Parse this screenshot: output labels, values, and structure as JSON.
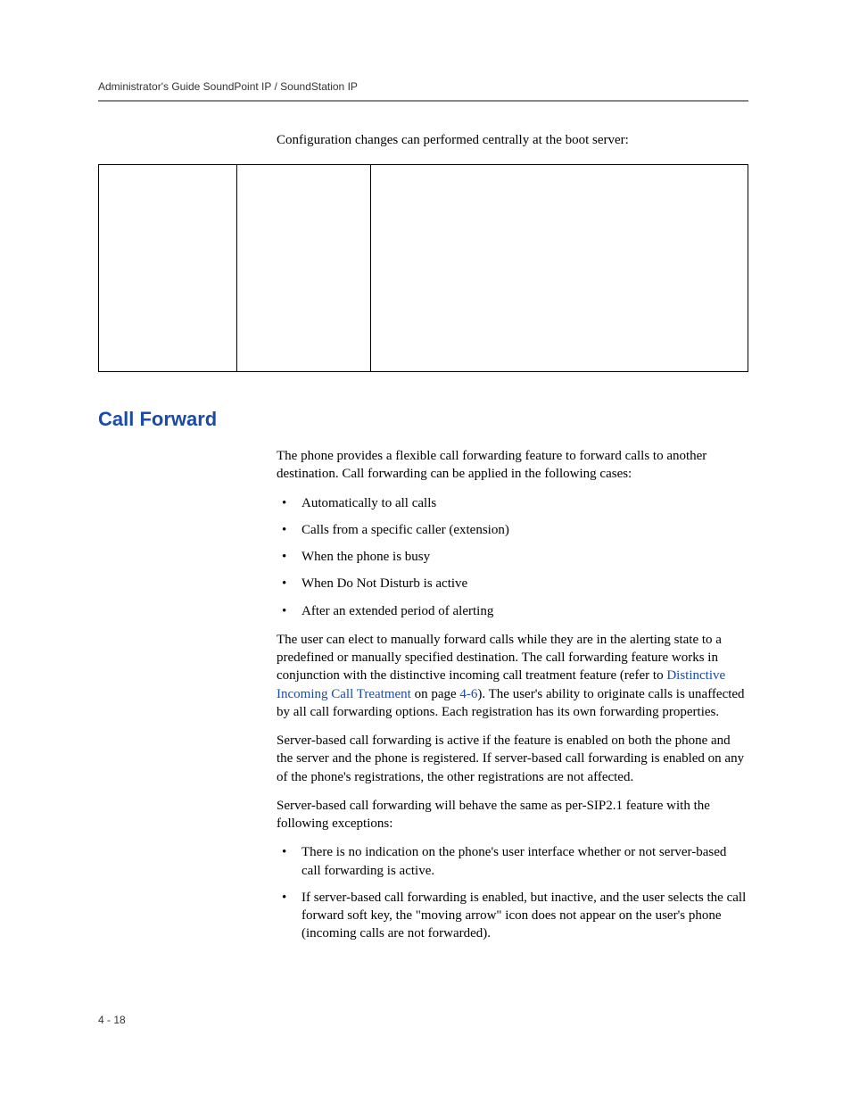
{
  "header": {
    "running_title": "Administrator's Guide SoundPoint IP / SoundStation IP"
  },
  "intro": "Configuration changes can performed centrally at the boot server:",
  "section": {
    "heading": "Call Forward",
    "para1": "The phone provides a flexible call forwarding feature to forward calls to another destination. Call forwarding can be applied in the following cases:",
    "bullets1": [
      "Automatically to all calls",
      "Calls from a specific caller (extension)",
      "When the phone is busy",
      "When Do Not Disturb is active",
      "After an extended period of alerting"
    ],
    "para2_pre": "The user can elect to manually forward calls while they are in the alerting state to a predefined or manually specified destination. The call forwarding feature works in conjunction with the distinctive incoming call treatment feature (refer to ",
    "para2_link": "Distinctive Incoming Call Treatment",
    "para2_mid": " on page ",
    "para2_pageref": "4-6",
    "para2_post": "). The user's ability to originate calls is unaffected by all call forwarding options. Each registration has its own forwarding properties.",
    "para3": "Server-based call forwarding is active if the feature is enabled on both the phone and the server and the phone is registered. If server-based call forwarding is enabled on any of the phone's registrations, the other registrations are not affected.",
    "para4": "Server-based call forwarding will behave the same as per-SIP2.1 feature with the following exceptions:",
    "bullets2": [
      "There is no indication on the phone's user interface whether or not server-based call forwarding is active.",
      "If server-based call forwarding is enabled, but inactive, and the user selects the call forward soft key, the \"moving arrow\" icon does not appear on the user's phone (incoming calls are not forwarded)."
    ]
  },
  "page_number": "4 - 18"
}
